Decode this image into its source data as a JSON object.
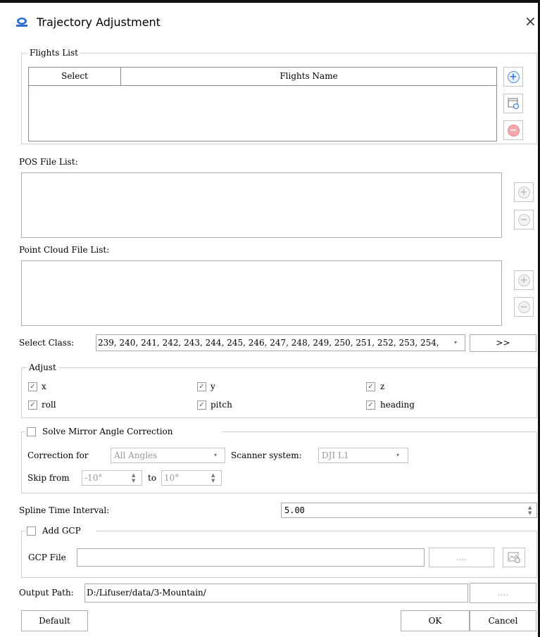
{
  "window": {
    "title": "Trajectory Adjustment",
    "close_glyph": "×"
  },
  "flights": {
    "legend": "Flights List",
    "columns": [
      "Select",
      "Flights Name"
    ],
    "add_glyph": "+",
    "import_glyph": "⊡",
    "remove_glyph": "−"
  },
  "pos": {
    "label": "POS File List:",
    "add_glyph": "+",
    "remove_glyph": "−"
  },
  "point_cloud": {
    "label": "Point Cloud File List:",
    "add_glyph": "+",
    "remove_glyph": "−"
  },
  "select_class": {
    "label": "Select Class:",
    "value": "239, 240, 241, 242, 243, 244, 245, 246, 247, 248, 249, 250, 251, 252, 253, 254,",
    "dropdown_glyph": "▾",
    "more_label": ">>"
  },
  "adjust": {
    "legend": "Adjust",
    "items": [
      {
        "label": "x",
        "checked": true
      },
      {
        "label": "y",
        "checked": true
      },
      {
        "label": "z",
        "checked": true
      },
      {
        "label": "roll",
        "checked": true
      },
      {
        "label": "pitch",
        "checked": true
      },
      {
        "label": "heading",
        "checked": true
      }
    ],
    "check_glyph": "✓"
  },
  "mirror": {
    "legend": "Solve Mirror Angle Correction",
    "enabled": false,
    "correction_label": "Correction for",
    "correction_value": "All Angles",
    "scanner_label": "Scanner system:",
    "scanner_value": "DJI L1",
    "skip_label": "Skip from",
    "skip_from": "-10°",
    "to_label": "to",
    "skip_to": "10°",
    "dropdown_glyph": "▾",
    "spin_up": "▲",
    "spin_down": "▼"
  },
  "spline": {
    "label": "Spline Time Interval:",
    "value": "5.00",
    "spin_up": "▲",
    "spin_down": "▼"
  },
  "gcp": {
    "legend": "Add GCP",
    "enabled": false,
    "file_label": "GCP File",
    "file_value": "",
    "browse_label": "....",
    "settings_glyph": "⚙"
  },
  "output": {
    "label": "Output Path:",
    "value": "D:/Lifuser/data/3-Mountain/",
    "browse_label": "...."
  },
  "buttons": {
    "default": "Default",
    "ok": "OK",
    "cancel": "Cancel"
  }
}
